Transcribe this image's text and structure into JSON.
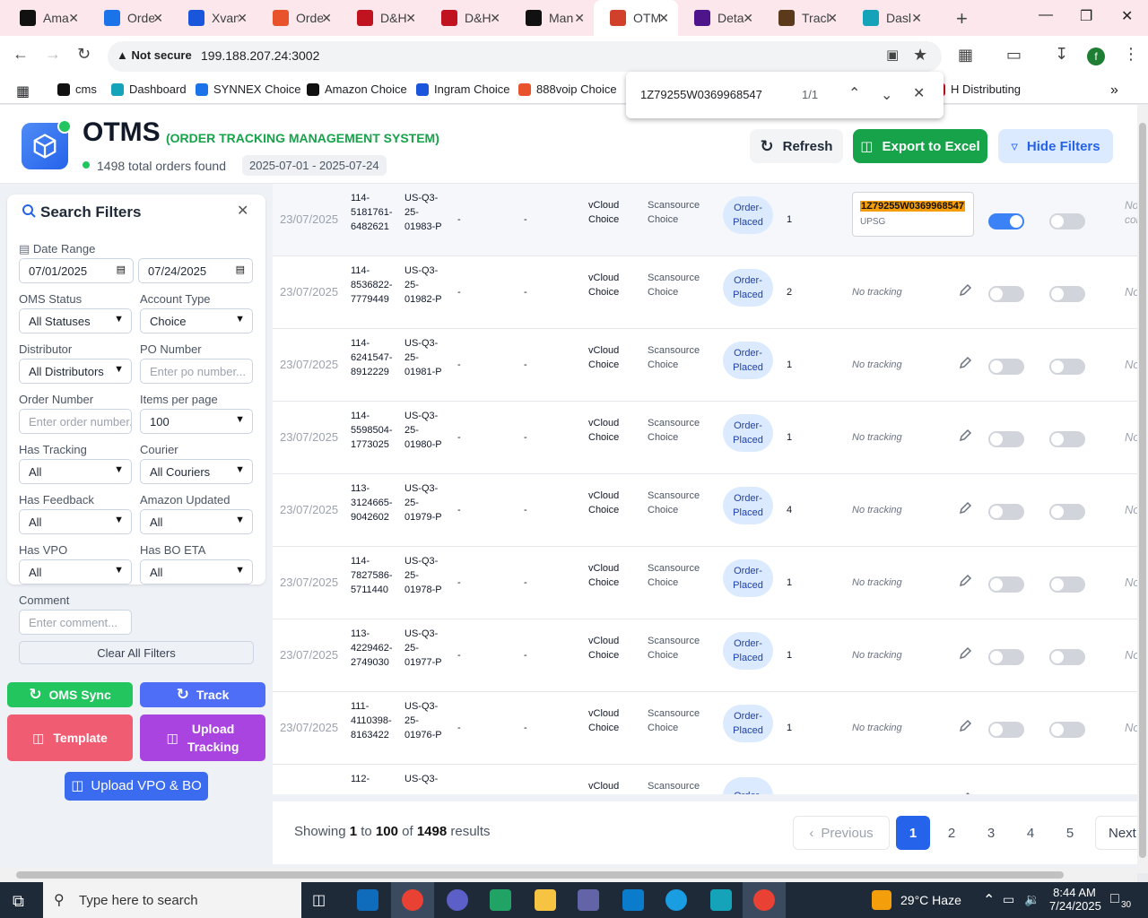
{
  "browser": {
    "tabs": [
      {
        "label": "Ama",
        "icon": "amazon-icon",
        "color": "#111111"
      },
      {
        "label": "Orde",
        "icon": "ec-icon",
        "color": "#1a73e8"
      },
      {
        "label": "Xvan",
        "icon": "xvantage-icon",
        "color": "#1a56db"
      },
      {
        "label": "Orde",
        "icon": "orders-icon",
        "color": "#e8532b"
      },
      {
        "label": "D&H",
        "icon": "dh-icon",
        "color": "#c1121f"
      },
      {
        "label": "D&H",
        "icon": "dh-icon",
        "color": "#c1121f"
      },
      {
        "label": "Man",
        "icon": "amazon-icon",
        "color": "#111111"
      },
      {
        "label": "OTM",
        "icon": "otms-icon",
        "color": "#d0402b"
      },
      {
        "label": "Deta",
        "icon": "fedex-icon",
        "color": "#4d148c"
      },
      {
        "label": "Tracl",
        "icon": "ups-icon",
        "color": "#5a3a1b"
      },
      {
        "label": "Dasl",
        "icon": "dashboard-icon",
        "color": "#14a3b8"
      }
    ],
    "security": "Not secure",
    "url": "199.188.207.24:3002",
    "profile_initial": "f",
    "bookmarks": [
      {
        "label": "cms",
        "color": "#111111"
      },
      {
        "label": "Dashboard",
        "color": "#14a3b8"
      },
      {
        "label": "SYNNEX Choice",
        "color": "#1a73e8"
      },
      {
        "label": "Amazon Choice",
        "color": "#111111"
      },
      {
        "label": "Ingram Choice",
        "color": "#1a56db"
      },
      {
        "label": "888voip Choice",
        "color": "#e8532b"
      },
      {
        "label": "H Distributing",
        "color": "#c1121f"
      }
    ],
    "find": {
      "query": "1Z79255W0369968547",
      "count": "1/1"
    }
  },
  "header": {
    "title": "OTMS",
    "subtitle": "(ORDER TRACKING MANAGEMENT SYSTEM)",
    "total_orders": "1498 total orders found",
    "date_range": "2025-07-01 - 2025-07-24",
    "refresh_label": "Refresh",
    "export_label": "Export to Excel",
    "hide_filters_label": "Hide Filters"
  },
  "filters": {
    "title": "Search Filters",
    "date_range_label": "Date Range",
    "date_from": "07/01/2025",
    "date_to": "07/24/2025",
    "oms_status_label": "OMS Status",
    "oms_status_value": "All Statuses",
    "account_type_label": "Account Type",
    "account_type_value": "Choice",
    "distributor_label": "Distributor",
    "distributor_value": "All Distributors",
    "po_number_label": "PO Number",
    "po_number_placeholder": "Enter po number...",
    "order_number_label": "Order Number",
    "order_number_placeholder": "Enter order number...",
    "items_per_page_label": "Items per page",
    "items_per_page_value": "100",
    "has_tracking_label": "Has Tracking",
    "has_tracking_value": "All",
    "courier_label": "Courier",
    "courier_value": "All Couriers",
    "has_feedback_label": "Has Feedback",
    "has_feedback_value": "All",
    "amazon_updated_label": "Amazon Updated",
    "amazon_updated_value": "All",
    "has_vpo_label": "Has VPO",
    "has_vpo_value": "All",
    "has_bo_eta_label": "Has BO ETA",
    "has_bo_eta_value": "All",
    "comment_label": "Comment",
    "comment_placeholder": "Enter comment...",
    "clear_label": "Clear All Filters"
  },
  "actions": {
    "oms_sync": "OMS Sync",
    "track": "Track",
    "template": "Template",
    "upload_tracking_1": "Upload",
    "upload_tracking_2": "Tracking",
    "upload_vpo": "Upload VPO & BO"
  },
  "table": {
    "tracking_number": "1Z79255W0369968547",
    "tracking_courier": "UPSG",
    "no_tracking": "No tracking",
    "no_comment_first_1": "No",
    "no_comment_first_2": "comm",
    "no_comment": "No cc",
    "rows": [
      {
        "date": "23/07/2025",
        "o1": "114-",
        "o2": "5181761-",
        "o3": "6482621",
        "p1": "US-Q3-",
        "p2": "25-",
        "p3": "01983-P",
        "d1": "-",
        "d2": "-",
        "a1": "vCloud",
        "a2": "Choice",
        "s1": "Scansource",
        "s2": "Choice",
        "st1": "Order-",
        "st2": "Placed",
        "qty": "1",
        "tracked": true,
        "vpo": true,
        "bo": false
      },
      {
        "date": "23/07/2025",
        "o1": "114-",
        "o2": "8536822-",
        "o3": "7779449",
        "p1": "US-Q3-",
        "p2": "25-",
        "p3": "01982-P",
        "d1": "-",
        "d2": "-",
        "a1": "vCloud",
        "a2": "Choice",
        "s1": "Scansource",
        "s2": "Choice",
        "st1": "Order-",
        "st2": "Placed",
        "qty": "2",
        "tracked": false,
        "vpo": false,
        "bo": false
      },
      {
        "date": "23/07/2025",
        "o1": "114-",
        "o2": "6241547-",
        "o3": "8912229",
        "p1": "US-Q3-",
        "p2": "25-",
        "p3": "01981-P",
        "d1": "-",
        "d2": "-",
        "a1": "vCloud",
        "a2": "Choice",
        "s1": "Scansource",
        "s2": "Choice",
        "st1": "Order-",
        "st2": "Placed",
        "qty": "1",
        "tracked": false,
        "vpo": false,
        "bo": false
      },
      {
        "date": "23/07/2025",
        "o1": "114-",
        "o2": "5598504-",
        "o3": "1773025",
        "p1": "US-Q3-",
        "p2": "25-",
        "p3": "01980-P",
        "d1": "-",
        "d2": "-",
        "a1": "vCloud",
        "a2": "Choice",
        "s1": "Scansource",
        "s2": "Choice",
        "st1": "Order-",
        "st2": "Placed",
        "qty": "1",
        "tracked": false,
        "vpo": false,
        "bo": false
      },
      {
        "date": "23/07/2025",
        "o1": "113-",
        "o2": "3124665-",
        "o3": "9042602",
        "p1": "US-Q3-",
        "p2": "25-",
        "p3": "01979-P",
        "d1": "-",
        "d2": "-",
        "a1": "vCloud",
        "a2": "Choice",
        "s1": "Scansource",
        "s2": "Choice",
        "st1": "Order-",
        "st2": "Placed",
        "qty": "4",
        "tracked": false,
        "vpo": false,
        "bo": false
      },
      {
        "date": "23/07/2025",
        "o1": "114-",
        "o2": "7827586-",
        "o3": "5711440",
        "p1": "US-Q3-",
        "p2": "25-",
        "p3": "01978-P",
        "d1": "-",
        "d2": "-",
        "a1": "vCloud",
        "a2": "Choice",
        "s1": "Scansource",
        "s2": "Choice",
        "st1": "Order-",
        "st2": "Placed",
        "qty": "1",
        "tracked": false,
        "vpo": false,
        "bo": false
      },
      {
        "date": "23/07/2025",
        "o1": "113-",
        "o2": "4229462-",
        "o3": "2749030",
        "p1": "US-Q3-",
        "p2": "25-",
        "p3": "01977-P",
        "d1": "-",
        "d2": "-",
        "a1": "vCloud",
        "a2": "Choice",
        "s1": "Scansource",
        "s2": "Choice",
        "st1": "Order-",
        "st2": "Placed",
        "qty": "1",
        "tracked": false,
        "vpo": false,
        "bo": false
      },
      {
        "date": "23/07/2025",
        "o1": "111-",
        "o2": "4110398-",
        "o3": "8163422",
        "p1": "US-Q3-",
        "p2": "25-",
        "p3": "01976-P",
        "d1": "-",
        "d2": "-",
        "a1": "vCloud",
        "a2": "Choice",
        "s1": "Scansource",
        "s2": "Choice",
        "st1": "Order-",
        "st2": "Placed",
        "qty": "1",
        "tracked": false,
        "vpo": false,
        "bo": false
      },
      {
        "date": "",
        "o1": "112-",
        "o2": "",
        "o3": "",
        "p1": "US-Q3-",
        "p2": "",
        "p3": "",
        "d1": "",
        "d2": "",
        "a1": "vCloud",
        "a2": "",
        "s1": "Scansource",
        "s2": "",
        "st1": "Order-",
        "st2": "",
        "qty": "",
        "tracked": false,
        "vpo": false,
        "bo": false
      }
    ]
  },
  "pagination": {
    "showing": "Showing",
    "from": "1",
    "to_word": "to",
    "to": "100",
    "of_word": "of",
    "total": "1498",
    "results_word": "results",
    "previous": "Previous",
    "pages": [
      "1",
      "2",
      "3",
      "4",
      "5"
    ],
    "next": "Next"
  },
  "taskbar": {
    "search_placeholder": "Type here to search",
    "weather": "29°C  Haze",
    "time": "8:44 AM",
    "date": "7/24/2025",
    "notifications": "30"
  }
}
